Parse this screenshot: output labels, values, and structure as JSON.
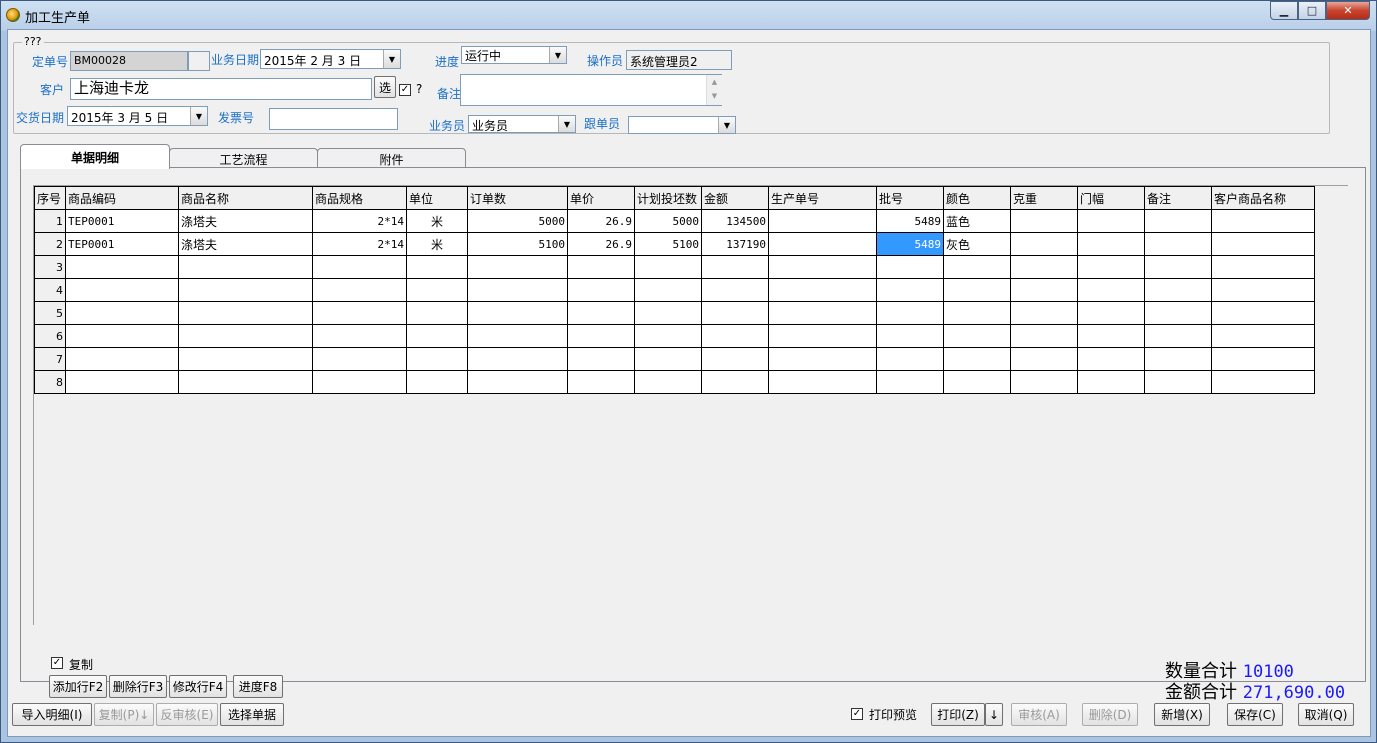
{
  "window": {
    "title": "加工生产单",
    "minimize": "▁",
    "maximize": "□",
    "close": "✕"
  },
  "header": {
    "group_title": "???",
    "order_no_label": "定单号",
    "order_no_value": "BM00028",
    "biz_date_label": "业务日期",
    "biz_date_value": "2015年 2 月 3 日",
    "progress_label": "进度",
    "progress_value": "运行中",
    "operator_label": "操作员",
    "operator_value": "系统管理员2",
    "customer_label": "客户",
    "customer_value": "上海迪卡龙",
    "select_button": "选",
    "question_mark": "?",
    "remark_label": "备注",
    "remark_value": "",
    "delivery_date_label": "交货日期",
    "delivery_date_value": "2015年 3 月 5 日",
    "invoice_label": "发票号",
    "invoice_value": "",
    "salesperson_label": "业务员",
    "salesperson_value": "业务员",
    "follower_label": "跟单员",
    "follower_value": ""
  },
  "tabs": [
    {
      "label": "单据明细",
      "active": true
    },
    {
      "label": "工艺流程",
      "active": false
    },
    {
      "label": "附件",
      "active": false
    }
  ],
  "grid": {
    "columns": [
      "序号",
      "商品编码",
      "商品名称",
      "商品规格",
      "单位",
      "订单数",
      "单价",
      "计划投坯数",
      "金额",
      "生产单号",
      "批号",
      "颜色",
      "克重",
      "门幅",
      "备注",
      "客户商品名称"
    ],
    "rows": [
      [
        "1",
        "TEP0001",
        "涤塔夫",
        "2*14",
        "米",
        "5000",
        "26.9",
        "5000",
        "134500",
        "",
        "5489",
        "蓝色",
        "",
        "",
        "",
        ""
      ],
      [
        "2",
        "TEP0001",
        "涤塔夫",
        "2*14",
        "米",
        "5100",
        "26.9",
        "5100",
        "137190",
        "",
        "5489",
        "灰色",
        "",
        "",
        "",
        ""
      ],
      [
        "3",
        "",
        "",
        "",
        "",
        "",
        "",
        "",
        "",
        "",
        "",
        "",
        "",
        "",
        "",
        ""
      ],
      [
        "4",
        "",
        "",
        "",
        "",
        "",
        "",
        "",
        "",
        "",
        "",
        "",
        "",
        "",
        "",
        ""
      ],
      [
        "5",
        "",
        "",
        "",
        "",
        "",
        "",
        "",
        "",
        "",
        "",
        "",
        "",
        "",
        "",
        ""
      ],
      [
        "6",
        "",
        "",
        "",
        "",
        "",
        "",
        "",
        "",
        "",
        "",
        "",
        "",
        "",
        "",
        ""
      ],
      [
        "7",
        "",
        "",
        "",
        "",
        "",
        "",
        "",
        "",
        "",
        "",
        "",
        "",
        "",
        "",
        ""
      ],
      [
        "8",
        "",
        "",
        "",
        "",
        "",
        "",
        "",
        "",
        "",
        "",
        "",
        "",
        "",
        "",
        ""
      ]
    ]
  },
  "detail_actions": {
    "copy_label": "复制",
    "add_row": "添加行F2",
    "delete_row": "删除行F3",
    "edit_row": "修改行F4",
    "progress": "进度F8"
  },
  "totals": {
    "qty_label": "数量合计",
    "qty_value": "10100",
    "amount_label": "金额合计",
    "amount_value": "271,690.00"
  },
  "footer": {
    "import_detail": "导入明细(I)",
    "copy": "复制(P)↓",
    "unapprove": "反审核(E)",
    "select_doc": "选择单据",
    "print_preview_label": "打印预览",
    "print": "打印(Z)",
    "print_arrow": "↓",
    "approve": "审核(A)",
    "delete": "删除(D)",
    "new": "新增(X)",
    "save": "保存(C)",
    "cancel": "取消(Q)"
  }
}
